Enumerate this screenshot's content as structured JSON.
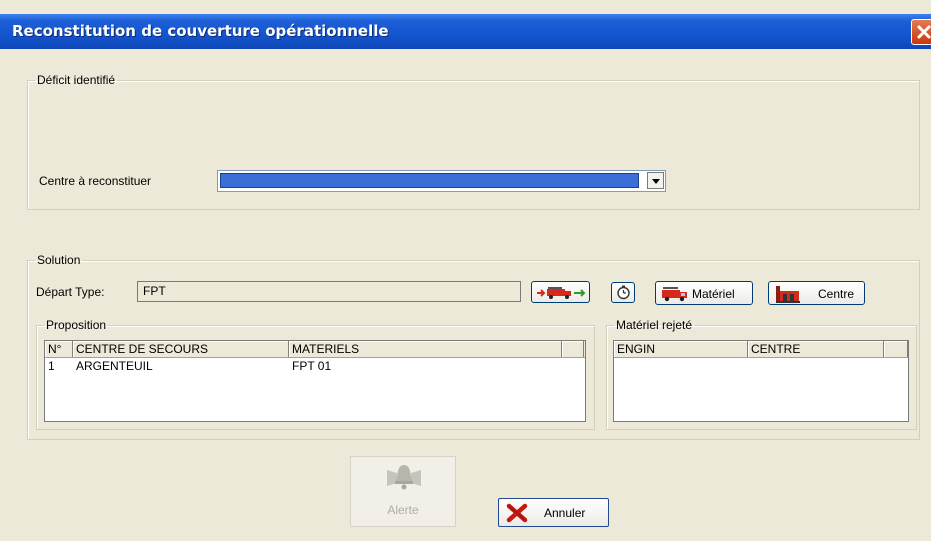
{
  "window": {
    "title": "Reconstitution de couverture opérationnelle"
  },
  "deficit": {
    "legend": "Déficit identifié",
    "centre_label": "Centre à reconstituer",
    "centre_value": ""
  },
  "solution": {
    "legend": "Solution",
    "depart_label": "Départ Type:",
    "depart_value": "FPT",
    "buttons": {
      "materiel": "Matériel",
      "centre": "Centre"
    }
  },
  "proposition": {
    "legend": "Proposition",
    "columns": [
      "N°",
      "CENTRE DE SECOURS",
      "MATERIELS"
    ],
    "rows": [
      {
        "num": "1",
        "centre": "ARGENTEUIL",
        "materiels": "FPT 01"
      }
    ]
  },
  "rejete": {
    "legend": "Matériel rejeté",
    "columns": [
      "ENGIN",
      "CENTRE"
    ]
  },
  "actions": {
    "alerte": "Alerte",
    "annuler": "Annuler"
  },
  "colors": {
    "titlebar": "#1456d2",
    "dialog_bg": "#ece9d8",
    "selection": "#3a6fd8",
    "truck_red": "#d42a1e"
  },
  "icons": [
    "close-icon",
    "dropdown-arrow-icon",
    "truck-arrows-icon",
    "clock-icon",
    "truck-icon",
    "building-icon",
    "bell-icon",
    "cancel-x-icon"
  ]
}
